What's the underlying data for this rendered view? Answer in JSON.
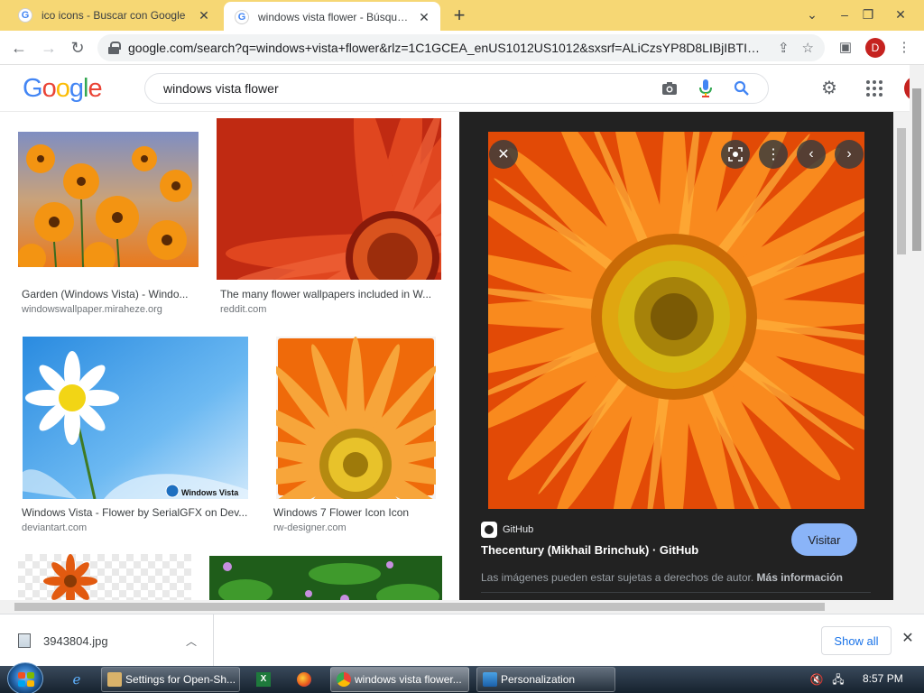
{
  "browser": {
    "tabs": [
      {
        "title": "ico icons - Buscar con Google",
        "favicon": "G"
      },
      {
        "title": "windows vista flower - Búsqueda",
        "favicon": "G"
      }
    ],
    "new_tab": "+",
    "url": "google.com/search?q=windows+vista+flower&rlz=1C1GCEA_enUS1012US1012&sxsrf=ALiCzsYP8D8LIBjIBTIqpB...",
    "profile_initial": "D"
  },
  "google": {
    "logo": [
      "G",
      "o",
      "o",
      "g",
      "l",
      "e"
    ],
    "query": "windows vista flower"
  },
  "results": [
    {
      "title": "Garden (Windows Vista) - Windo...",
      "domain": "windowswallpaper.miraheze.org"
    },
    {
      "title": "The many flower wallpapers included in W...",
      "domain": "reddit.com"
    },
    {
      "title": "Windows Vista - Flower by SerialGFX on Dev...",
      "domain": "deviantart.com",
      "watermark": "Windows Vista"
    },
    {
      "title": "Windows 7 Flower Icon Icon",
      "domain": "rw-designer.com"
    }
  ],
  "preview": {
    "source": "GitHub",
    "title": "Thecentury (Mikhail Brinchuk) · GitHub",
    "visit": "Visitar",
    "copyright": "Las imágenes pueden estar sujetas a derechos de autor.",
    "more_info": "Más información"
  },
  "downloads": {
    "file": "3943804.jpg",
    "show_all": "Show all"
  },
  "taskbar": {
    "tasks": [
      "Settings for Open-Sh...",
      "windows vista flower...",
      "Personalization"
    ],
    "time": "8:57 PM"
  },
  "colors": {
    "tab_strip": "#f6d774",
    "preview_bg": "#222222",
    "visit_button": "#8ab4f8",
    "link_blue": "#1a73e8"
  }
}
